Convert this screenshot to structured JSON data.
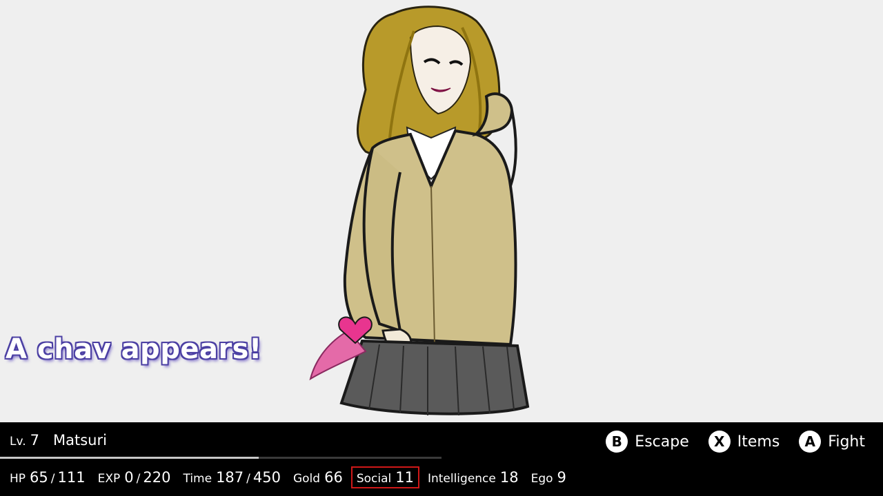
{
  "encounter": {
    "message": "A chav appears!"
  },
  "player": {
    "level_label": "Lv.",
    "level": "7",
    "name": "Matsuri",
    "exp_progress": 0.586
  },
  "stats": {
    "hp": {
      "label": "HP",
      "current": "65",
      "max": "111"
    },
    "exp": {
      "label": "EXP",
      "current": "0",
      "max": "220"
    },
    "time": {
      "label": "Time",
      "current": "187",
      "max": "450"
    },
    "gold": {
      "label": "Gold",
      "value": "66"
    },
    "social": {
      "label": "Social",
      "value": "11"
    },
    "intelligence": {
      "label": "Intelligence",
      "value": "18"
    },
    "ego": {
      "label": "Ego",
      "value": "9"
    },
    "separator": "/"
  },
  "actions": [
    {
      "button": "B",
      "label": "Escape"
    },
    {
      "button": "X",
      "label": "Items"
    },
    {
      "button": "A",
      "label": "Fight"
    }
  ],
  "colors": {
    "highlight": "#d01818",
    "text_outline": "#4b3fa3",
    "hud_bg": "#000000",
    "scene_bg": "#efefef"
  }
}
